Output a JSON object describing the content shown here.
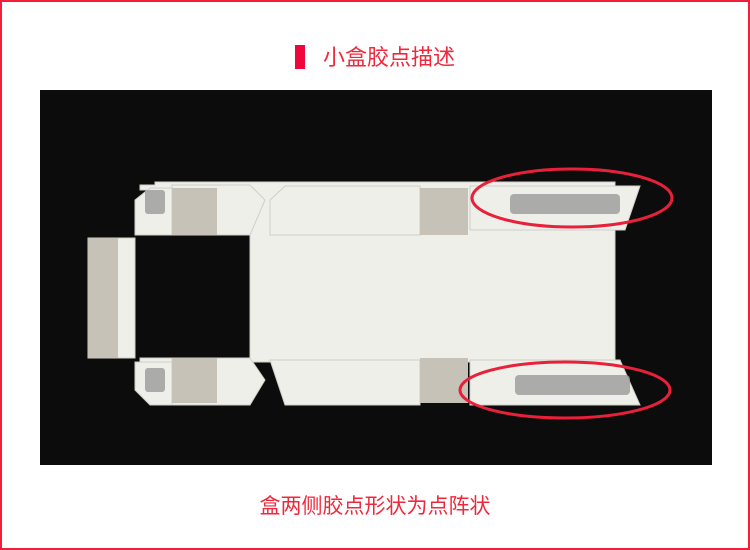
{
  "header": {
    "title": "小盒胶点描述"
  },
  "photo": {
    "subject": "unfolded small box with glue dot patterns",
    "highlight_color": "#e8203a"
  },
  "caption": "盒两侧胶点形状为点阵状",
  "colors": {
    "accent": "#f0283c",
    "border": "#f0203a"
  }
}
